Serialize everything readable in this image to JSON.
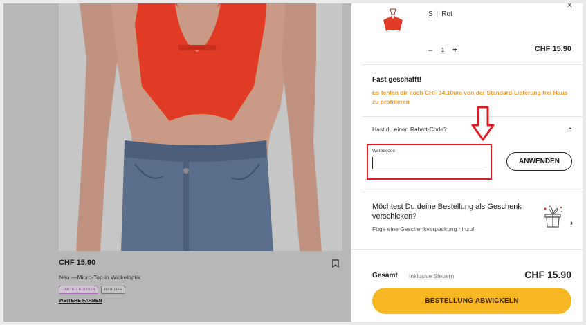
{
  "product": {
    "price": "CHF 15.90",
    "name": "Neu —Micro-Top in Wickeloptik",
    "badges": [
      "LIMITED EDITION",
      "JOIN LIFE"
    ],
    "more_colors": "WEITERE FARBEN"
  },
  "cart": {
    "item": {
      "size": "S",
      "separator": "|",
      "color": "Rot",
      "qty_minus": "–",
      "qty": "1",
      "qty_plus": "+",
      "price": "CHF 15.90"
    },
    "shipping": {
      "title": "Fast geschafft!",
      "message": "Es fehlen dir noch CHF 34.10um von der Standard-Lieferung frei Haus zu profitieren"
    },
    "coupon": {
      "question": "Hast du einen Rabatt-Code?",
      "toggle": "-",
      "label": "Werbecode",
      "value": "",
      "apply_label": "ANWENDEN"
    },
    "gift": {
      "title": "Möchtest Du deine Bestellung als Geschenk verschicken?",
      "subtitle": "Füge eine Geschenkverpackung hinzu!",
      "chevron": "›"
    },
    "total": {
      "label": "Gesamt",
      "tax_note": "Inklusive Steuern",
      "value": "CHF 15.90"
    },
    "checkout_label": "BESTELLUNG ABWICKELN"
  },
  "colors": {
    "accent_orange": "#f29a1f",
    "checkout_yellow": "#f6b722",
    "highlight_red": "#e01b24",
    "product_red": "#e23b25"
  }
}
